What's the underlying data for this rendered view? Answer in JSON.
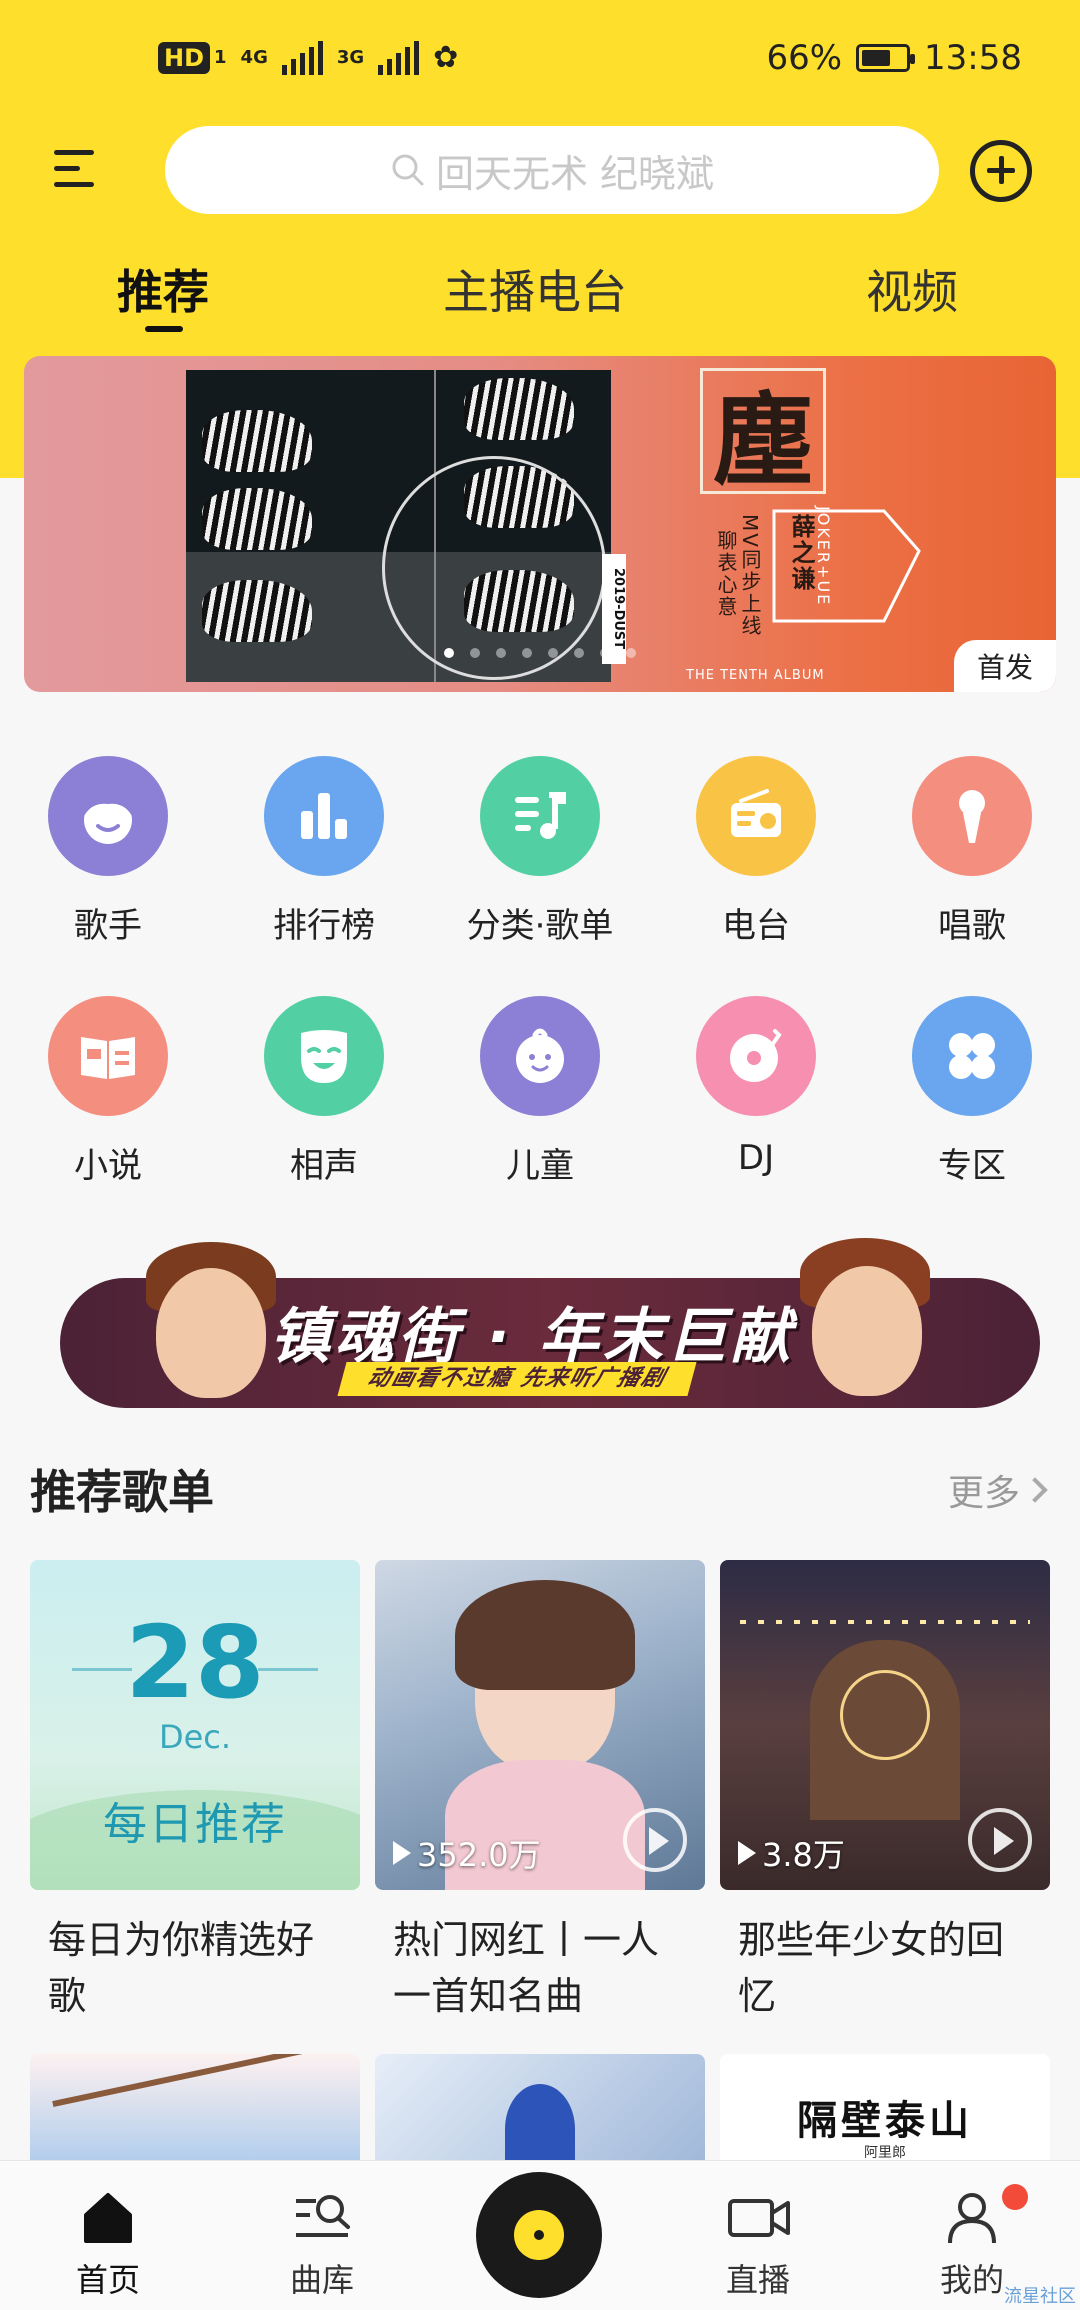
{
  "status_bar": {
    "hd": "HD",
    "sim1": "1",
    "net1": "4G",
    "net2": "3G",
    "battery_text": "66%",
    "battery_level": 0.66,
    "time": "13:58"
  },
  "search": {
    "placeholder": "回天无术  纪晓斌"
  },
  "tabs": [
    {
      "label": "推荐",
      "active": true
    },
    {
      "label": "主播电台",
      "active": false
    },
    {
      "label": "视频",
      "active": false
    }
  ],
  "banner": {
    "album_tag": "2019-DUST",
    "calligraphy": "塵",
    "promo_line1": "MV同步上线",
    "promo_line2": "聊表心意",
    "artist_line": "薛之谦",
    "artist_en": "JOKER+UE",
    "footer": "THE TENTH ALBUM",
    "badge": "首发",
    "dots_total": 8,
    "dots_active": 0
  },
  "categories": [
    {
      "label": "歌手",
      "icon": "singer-icon",
      "color": "#8b7fd6"
    },
    {
      "label": "排行榜",
      "icon": "chart-icon",
      "color": "#6aa5ef"
    },
    {
      "label": "分类·歌单",
      "icon": "playlist-icon",
      "color": "#52d0a3"
    },
    {
      "label": "电台",
      "icon": "radio-icon",
      "color": "#f9c445"
    },
    {
      "label": "唱歌",
      "icon": "microphone-icon",
      "color": "#f48e7f"
    },
    {
      "label": "小说",
      "icon": "book-icon",
      "color": "#f48e7f"
    },
    {
      "label": "相声",
      "icon": "mask-icon",
      "color": "#52d0a3"
    },
    {
      "label": "儿童",
      "icon": "baby-icon",
      "color": "#8b7fd6"
    },
    {
      "label": "DJ",
      "icon": "turntable-icon",
      "color": "#f790b0"
    },
    {
      "label": "专区",
      "icon": "grid-icon",
      "color": "#6aa5ef"
    }
  ],
  "promo": {
    "title": "镇魂街 · 年末巨献",
    "subtitle": "动画看不过瘾  先来听广播剧"
  },
  "section": {
    "title": "推荐歌单",
    "more": "更多"
  },
  "playlists": [
    {
      "title": "每日为你精选好歌",
      "date": "28",
      "month": "Dec.",
      "daily_label": "每日推荐"
    },
    {
      "title": "热门网红丨一人一首知名曲",
      "plays": "352.0万"
    },
    {
      "title": "那些年少女的回忆",
      "plays": "3.8万"
    }
  ],
  "second_row": {
    "third_title": "隔壁泰山",
    "third_sub": "阿里郎"
  },
  "bottom_nav": [
    {
      "label": "首页",
      "icon": "home-icon",
      "active": true
    },
    {
      "label": "曲库",
      "icon": "library-icon",
      "active": false
    },
    {
      "label": "",
      "icon": "player-disc-icon",
      "active": false
    },
    {
      "label": "直播",
      "icon": "live-camera-icon",
      "active": false
    },
    {
      "label": "我的",
      "icon": "profile-icon",
      "active": false
    }
  ],
  "watermark": "流星社区"
}
